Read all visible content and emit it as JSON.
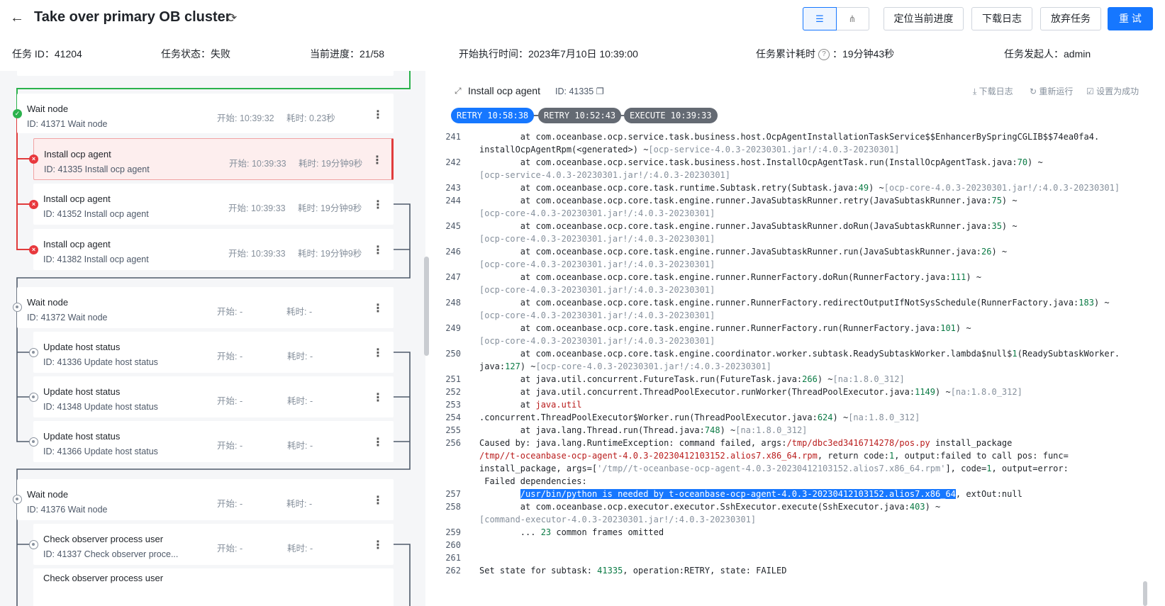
{
  "header": {
    "title": "Take over primary OB cluster",
    "buttons": [
      "定位当前进度",
      "下载日志",
      "放弃任务",
      "重 试"
    ],
    "meta": {
      "task_id": "任务 ID：41204",
      "status": "任务状态：失败",
      "progress": "当前进度：21/58",
      "start_time": "开始执行时间：2023年7月10日 10:39:00",
      "elapsed_label": "任务累计耗时",
      "elapsed_value": "：19分钟43秒",
      "initiator": "任务发起人：admin"
    }
  },
  "nodes": [
    {
      "name": "Wait node",
      "sub": "ID: 41371  Wait node",
      "start": "开始:   10:39:32",
      "dur": "耗时:   0.23秒",
      "state": "ok"
    },
    {
      "name": "Install ocp agent",
      "sub": "ID: 41335  Install ocp agent",
      "start": "开始:   10:39:33",
      "dur": "耗时:   19分钟9秒",
      "state": "err"
    },
    {
      "name": "Install ocp agent",
      "sub": "ID: 41352  Install ocp agent",
      "start": "开始:   10:39:33",
      "dur": "耗时:   19分钟9秒",
      "state": "err"
    },
    {
      "name": "Install ocp agent",
      "sub": "ID: 41382  Install ocp agent",
      "start": "开始:   10:39:33",
      "dur": "耗时:   19分钟9秒",
      "state": "err"
    },
    {
      "name": "Wait node",
      "sub": "ID: 41372  Wait node",
      "start": "开始:   -",
      "dur": "耗时:   -",
      "state": "pend"
    },
    {
      "name": "Update host status",
      "sub": "ID: 41336  Update host status",
      "start": "开始:   -",
      "dur": "耗时:   -",
      "state": "pend"
    },
    {
      "name": "Update host status",
      "sub": "ID: 41348  Update host status",
      "start": "开始:   -",
      "dur": "耗时:   -",
      "state": "pend"
    },
    {
      "name": "Update host status",
      "sub": "ID: 41366  Update host status",
      "start": "开始:   -",
      "dur": "耗时:   -",
      "state": "pend"
    },
    {
      "name": "Wait node",
      "sub": "ID: 41376  Wait node",
      "start": "开始:   -",
      "dur": "耗时:   -",
      "state": "pend"
    },
    {
      "name": "Check observer process user",
      "sub": "ID: 41337  Check observer proce...",
      "start": "开始:   -",
      "dur": "耗时:   -",
      "state": "pend"
    },
    {
      "name": "Check observer process user",
      "sub": "",
      "start": "",
      "dur": "",
      "state": "pend"
    }
  ],
  "detail": {
    "title": "Install ocp agent",
    "id": "ID: 41335",
    "actions": [
      "下载日志",
      "重新运行",
      "设置为成功"
    ],
    "pills": [
      "RETRY 10:58:38",
      "RETRY 10:52:43",
      "EXECUTE 10:39:33"
    ]
  },
  "log": [
    {
      "n": "241",
      "segs": [
        [
          "        at com.oceanbase.ocp.service.task.business.host.OcpAgentInstallationTaskService$$EnhancerBySpringCGLIB$$74ea0fa4.",
          ""
        ]
      ]
    },
    {
      "n": "",
      "segs": [
        [
          "installOcpAgentRpm(<generated>) ~",
          ""
        ],
        [
          "[ocp-service-4.0.3-20230301.jar!/:4.0.3-20230301]",
          "gy"
        ]
      ]
    },
    {
      "n": "242",
      "segs": [
        [
          "        at com.oceanbase.ocp.service.task.business.host.InstallOcpAgentTask.run(InstallOcpAgentTask.java:",
          ""
        ],
        [
          "70",
          "g"
        ],
        [
          ") ~",
          ""
        ]
      ]
    },
    {
      "n": "",
      "segs": [
        [
          "[ocp-service-4.0.3-20230301.jar!/:4.0.3-20230301]",
          "gy"
        ]
      ]
    },
    {
      "n": "243",
      "segs": [
        [
          "        at com.oceanbase.ocp.core.task.runtime.Subtask.retry(Subtask.java:",
          ""
        ],
        [
          "49",
          "g"
        ],
        [
          ") ~",
          ""
        ],
        [
          "[ocp-core-4.0.3-20230301.jar!/:4.0.3-20230301]",
          "gy"
        ]
      ]
    },
    {
      "n": "244",
      "segs": [
        [
          "        at com.oceanbase.ocp.core.task.engine.runner.JavaSubtaskRunner.retry(JavaSubtaskRunner.java:",
          ""
        ],
        [
          "75",
          "g"
        ],
        [
          ") ~",
          ""
        ]
      ]
    },
    {
      "n": "",
      "segs": [
        [
          "[ocp-core-4.0.3-20230301.jar!/:4.0.3-20230301]",
          "gy"
        ]
      ]
    },
    {
      "n": "245",
      "segs": [
        [
          "        at com.oceanbase.ocp.core.task.engine.runner.JavaSubtaskRunner.doRun(JavaSubtaskRunner.java:",
          ""
        ],
        [
          "35",
          "g"
        ],
        [
          ") ~",
          ""
        ]
      ]
    },
    {
      "n": "",
      "segs": [
        [
          "[ocp-core-4.0.3-20230301.jar!/:4.0.3-20230301]",
          "gy"
        ]
      ]
    },
    {
      "n": "246",
      "segs": [
        [
          "        at com.oceanbase.ocp.core.task.engine.runner.JavaSubtaskRunner.run(JavaSubtaskRunner.java:",
          ""
        ],
        [
          "26",
          "g"
        ],
        [
          ") ~",
          ""
        ]
      ]
    },
    {
      "n": "",
      "segs": [
        [
          "[ocp-core-4.0.3-20230301.jar!/:4.0.3-20230301]",
          "gy"
        ]
      ]
    },
    {
      "n": "247",
      "segs": [
        [
          "        at com.oceanbase.ocp.core.task.engine.runner.RunnerFactory.doRun(RunnerFactory.java:",
          ""
        ],
        [
          "111",
          "g"
        ],
        [
          ") ~",
          ""
        ]
      ]
    },
    {
      "n": "",
      "segs": [
        [
          "[ocp-core-4.0.3-20230301.jar!/:4.0.3-20230301]",
          "gy"
        ]
      ]
    },
    {
      "n": "248",
      "segs": [
        [
          "        at com.oceanbase.ocp.core.task.engine.runner.RunnerFactory.redirectOutputIfNotSysSchedule(RunnerFactory.java:",
          ""
        ],
        [
          "183",
          "g"
        ],
        [
          ") ~",
          ""
        ]
      ]
    },
    {
      "n": "",
      "segs": [
        [
          "[ocp-core-4.0.3-20230301.jar!/:4.0.3-20230301]",
          "gy"
        ]
      ]
    },
    {
      "n": "249",
      "segs": [
        [
          "        at com.oceanbase.ocp.core.task.engine.runner.RunnerFactory.run(RunnerFactory.java:",
          ""
        ],
        [
          "101",
          "g"
        ],
        [
          ") ~",
          ""
        ]
      ]
    },
    {
      "n": "",
      "segs": [
        [
          "[ocp-core-4.0.3-20230301.jar!/:4.0.3-20230301]",
          "gy"
        ]
      ]
    },
    {
      "n": "250",
      "segs": [
        [
          "        at com.oceanbase.ocp.core.task.engine.coordinator.worker.subtask.ReadySubtaskWorker.lambda$null$",
          ""
        ],
        [
          "1",
          "g"
        ],
        [
          "(ReadySubtaskWorker.",
          ""
        ]
      ]
    },
    {
      "n": "",
      "segs": [
        [
          "java:",
          ""
        ],
        [
          "127",
          "g"
        ],
        [
          ") ~",
          ""
        ],
        [
          "[ocp-core-4.0.3-20230301.jar!/:4.0.3-20230301]",
          "gy"
        ]
      ]
    },
    {
      "n": "251",
      "segs": [
        [
          "        at java.util.concurrent.FutureTask.run(FutureTask.java:",
          ""
        ],
        [
          "266",
          "g"
        ],
        [
          ") ~",
          ""
        ],
        [
          "[na:1.8.0_312]",
          "gy"
        ]
      ]
    },
    {
      "n": "252",
      "segs": [
        [
          "        at java.util.concurrent.ThreadPoolExecutor.runWorker(ThreadPoolExecutor.java:",
          ""
        ],
        [
          "1149",
          "g"
        ],
        [
          ") ~",
          ""
        ],
        [
          "[na:1.8.0_312]",
          "gy"
        ]
      ]
    },
    {
      "n": "253",
      "segs": [
        [
          "        at ",
          ""
        ],
        [
          "java.util",
          "r"
        ]
      ]
    },
    {
      "n": "254",
      "segs": [
        [
          ".concurrent.ThreadPoolExecutor$Worker.run(ThreadPoolExecutor.java:",
          ""
        ],
        [
          "624",
          "g"
        ],
        [
          ") ~",
          ""
        ],
        [
          "[na:1.8.0_312]",
          "gy"
        ]
      ]
    },
    {
      "n": "255",
      "segs": [
        [
          "        at java.lang.Thread.run(Thread.java:",
          ""
        ],
        [
          "748",
          "g"
        ],
        [
          ") ~",
          ""
        ],
        [
          "[na:1.8.0_312]",
          "gy"
        ]
      ]
    },
    {
      "n": "256",
      "segs": [
        [
          "Caused by: java.lang.RuntimeException: command failed, args:",
          ""
        ],
        [
          "/tmp/dbc3ed3416714278/pos.py",
          "r"
        ],
        [
          " install_package",
          ""
        ]
      ]
    },
    {
      "n": "",
      "segs": [
        [
          "/tmp//t-oceanbase-ocp-agent-4.0.3-20230412103152.alios7.x86_64.rpm",
          "r"
        ],
        [
          ", return code:",
          ""
        ],
        [
          "1",
          "g"
        ],
        [
          ", output:failed to call pos: func=",
          ""
        ]
      ]
    },
    {
      "n": "",
      "segs": [
        [
          "install_package, args=[",
          ""
        ],
        [
          "'/tmp//t-oceanbase-ocp-agent-4.0.3-20230412103152.alios7.x86_64.rpm'",
          "gy"
        ],
        [
          "], code=",
          ""
        ],
        [
          "1",
          "g"
        ],
        [
          ", output=error:",
          ""
        ]
      ]
    },
    {
      "n": "",
      "segs": [
        [
          " Failed dependencies:",
          ""
        ]
      ]
    },
    {
      "n": "257",
      "segs": [
        [
          "        ",
          ""
        ],
        [
          "/usr/bin/python is needed by t-oceanbase-ocp-agent-4.0.3-20230412103152.alios7.x86_64",
          "hl"
        ],
        [
          ", extOut:null",
          ""
        ]
      ]
    },
    {
      "n": "258",
      "segs": [
        [
          "        at com.oceanbase.ocp.executor.executor.SshExecutor.execute(SshExecutor.java:",
          ""
        ],
        [
          "403",
          "g"
        ],
        [
          ") ~",
          ""
        ]
      ]
    },
    {
      "n": "",
      "segs": [
        [
          "[command-executor-4.0.3-20230301.jar!/:4.0.3-20230301]",
          "gy"
        ]
      ]
    },
    {
      "n": "259",
      "segs": [
        [
          "        ... ",
          ""
        ],
        [
          "23",
          "g"
        ],
        [
          " common frames omitted",
          ""
        ]
      ]
    },
    {
      "n": "260",
      "segs": [
        [
          "",
          ""
        ]
      ]
    },
    {
      "n": "261",
      "segs": [
        [
          "",
          ""
        ]
      ]
    },
    {
      "n": "262",
      "segs": [
        [
          "Set state for subtask: ",
          ""
        ],
        [
          "41335",
          "g"
        ],
        [
          ", operation:RETRY, state: FAILED",
          ""
        ]
      ]
    }
  ]
}
